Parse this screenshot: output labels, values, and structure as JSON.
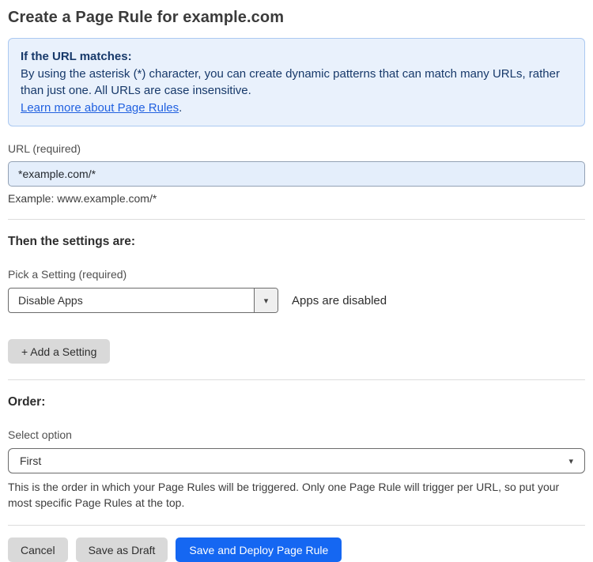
{
  "page": {
    "title": "Create a Page Rule for example.com"
  },
  "info_box": {
    "heading": "If the URL matches:",
    "body": "By using the asterisk (*) character, you can create dynamic patterns that can match many URLs, rather than just one. All URLs are case insensitive.",
    "link_label": "Learn more about Page Rules",
    "link_suffix": "."
  },
  "url_field": {
    "label": "URL (required)",
    "value": "*example.com/*",
    "example": "Example: www.example.com/*"
  },
  "settings": {
    "heading": "Then the settings are:",
    "picker_label": "Pick a Setting (required)",
    "selected_value": "Disable Apps",
    "status_text": "Apps are disabled",
    "add_button_label": "+ Add a Setting"
  },
  "order": {
    "heading": "Order:",
    "select_label": "Select option",
    "selected_value": "First",
    "help_text": "This is the order in which your Page Rules will be triggered. Only one Page Rule will trigger per URL, so put your most specific Page Rules at the top."
  },
  "footer": {
    "cancel_label": "Cancel",
    "save_draft_label": "Save as Draft",
    "save_deploy_label": "Save and Deploy Page Rule"
  },
  "icons": {
    "dropdown_arrow": "▾"
  },
  "colors": {
    "info_box_bg": "#e9f1fc",
    "info_box_border": "#abc9f1",
    "info_text": "#17396a",
    "link_blue": "#2161e0",
    "input_bg": "#e4eefb",
    "gray_button_bg": "#d9d9d9",
    "primary_button_bg": "#1567f2"
  }
}
